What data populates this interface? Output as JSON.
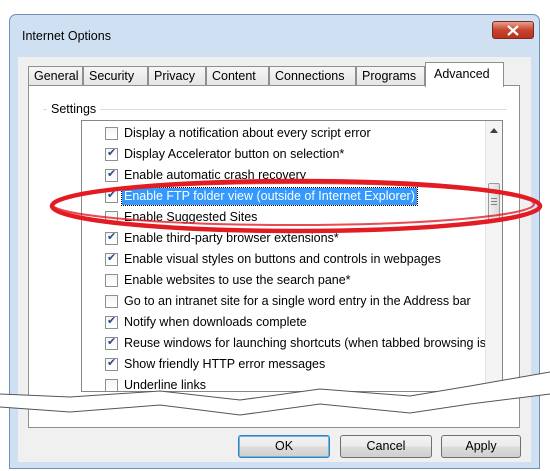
{
  "window": {
    "title": "Internet Options"
  },
  "tabs": [
    "General",
    "Security",
    "Privacy",
    "Content",
    "Connections",
    "Programs",
    "Advanced"
  ],
  "active_tab": "Advanced",
  "settings": {
    "group_label": "Settings",
    "items": [
      {
        "label": "Display a notification about every script error",
        "checked": false,
        "selected": false
      },
      {
        "label": "Display Accelerator button on selection*",
        "checked": true,
        "selected": false
      },
      {
        "label": "Enable automatic crash recovery",
        "checked": true,
        "selected": false
      },
      {
        "label": "Enable FTP folder view (outside of Internet Explorer)",
        "checked": true,
        "selected": true
      },
      {
        "label": "Enable Suggested Sites",
        "checked": false,
        "selected": false
      },
      {
        "label": "Enable third-party browser extensions*",
        "checked": true,
        "selected": false
      },
      {
        "label": "Enable visual styles on buttons and controls in webpages",
        "checked": true,
        "selected": false
      },
      {
        "label": "Enable websites to use the search pane*",
        "checked": false,
        "selected": false
      },
      {
        "label": "Go to an intranet site for a single word entry in the Address bar",
        "checked": false,
        "selected": false
      },
      {
        "label": "Notify when downloads complete",
        "checked": true,
        "selected": false
      },
      {
        "label": "Reuse windows for launching shortcuts (when tabbed browsing is on)",
        "checked": true,
        "selected": false
      },
      {
        "label": "Show friendly HTTP error messages",
        "checked": true,
        "selected": false
      },
      {
        "label": "Underline links",
        "checked": false,
        "selected": false
      }
    ]
  },
  "buttons": {
    "ok": "OK",
    "cancel": "Cancel",
    "apply": "Apply"
  },
  "colors": {
    "highlight_ellipse": "#e31b23",
    "selection": "#3399ff"
  }
}
